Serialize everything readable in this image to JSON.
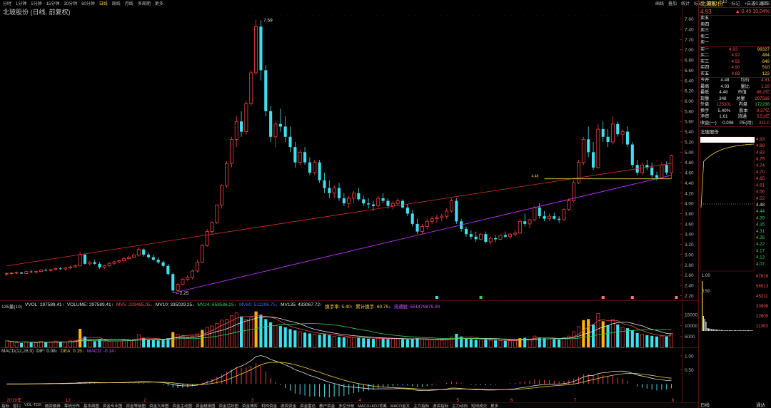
{
  "toolbar": {
    "left_items": [
      "分时",
      "1分钟",
      "5分钟",
      "15分钟",
      "30分钟",
      "60分钟",
      "日线",
      "周线",
      "月线",
      "多周期",
      "更多"
    ],
    "active_index": 6,
    "right_items": [
      "画线",
      "叠加",
      "统计",
      "标记",
      "回放",
      "F10",
      "标记",
      "+自选",
      "返回"
    ]
  },
  "subtitle": "北玻股份 (日线, 前复权)",
  "stock": {
    "name": "北玻股份",
    "code": "002613",
    "price": "4.93",
    "change": "0.45",
    "change_pct": "10.04%"
  },
  "order_book": {
    "sell": [
      {
        "label": "卖五",
        "price": "",
        "vol": ""
      },
      {
        "label": "卖四",
        "price": "",
        "vol": ""
      },
      {
        "label": "卖三",
        "price": "",
        "vol": ""
      },
      {
        "label": "卖二",
        "price": "",
        "vol": ""
      },
      {
        "label": "卖一",
        "price": "",
        "vol": ""
      }
    ],
    "buy": [
      {
        "label": "买一",
        "price": "4.93",
        "vol": "99327"
      },
      {
        "label": "买二",
        "price": "4.92",
        "vol": "484"
      },
      {
        "label": "买三",
        "price": "4.91",
        "vol": "649"
      },
      {
        "label": "买四",
        "price": "4.90",
        "vol": "510"
      },
      {
        "label": "买五",
        "price": "4.89",
        "vol": "122"
      }
    ]
  },
  "quote": [
    {
      "l1": "今开",
      "v1": "4.48",
      "l2": "均价",
      "v2": "4.81"
    },
    {
      "l1": "最高",
      "v1": "4.93",
      "l2": "量比",
      "v2": "1.18"
    },
    {
      "l1": "最低",
      "v1": "4.48",
      "l2": "市值",
      "v2": "46.2亿"
    },
    {
      "l1": "现量",
      "v1": "348",
      "l2": "总量",
      "v2": "297589"
    },
    {
      "l1": "外盘",
      "v1": "125301",
      "l2": "内盘",
      "v2": "172288"
    },
    {
      "l1": "换手",
      "v1": "5.40%",
      "l2": "股本",
      "v2": "9.37亿"
    },
    {
      "l1": "净资",
      "v1": "1.61",
      "l2": "流通",
      "v2": "5.51亿"
    },
    {
      "l1": "收益(一)",
      "v1": "0.006",
      "l2": "PE(动)",
      "v2": "211.0"
    }
  ],
  "mini_chart": {
    "title": "北玻股份",
    "price_ticks": [
      "4.93",
      "4.88",
      "4.83",
      "4.79",
      "4.74",
      "4.70",
      "4.65",
      "4.61",
      "4.56",
      "4.52",
      "4.48",
      "4.44",
      "4.39",
      "4.35",
      "4.31",
      "4.26",
      "4.22",
      "4.17",
      "4.13",
      "4.07"
    ],
    "vol_ticks": [
      "67816",
      "56513",
      "45211",
      "33908",
      "22605",
      "11303"
    ],
    "bottom_label": "日线",
    "bottom_right": "通达"
  },
  "chart_data": {
    "type": "candlestick",
    "y_ticks": [
      "7.60",
      "7.40",
      "7.20",
      "7.00",
      "6.80",
      "6.60",
      "6.40",
      "6.20",
      "6.00",
      "5.80",
      "5.60",
      "5.40",
      "5.20",
      "5.00",
      "4.80",
      "4.60",
      "4.40",
      "4.20",
      "4.00",
      "3.80",
      "3.60",
      "3.40",
      "3.20",
      "3.00",
      "2.80",
      "2.60",
      "2.40",
      "2.20"
    ],
    "ylim": [
      2.15,
      7.72
    ],
    "annotations": {
      "high": "7.59",
      "low": "2.25",
      "mid": "4.48"
    },
    "candles": [
      [
        2.62,
        2.65,
        2.58,
        2.63
      ],
      [
        2.63,
        2.66,
        2.6,
        2.64
      ],
      [
        2.64,
        2.67,
        2.61,
        2.65
      ],
      [
        2.65,
        2.66,
        2.62,
        2.63
      ],
      [
        2.63,
        2.68,
        2.62,
        2.67
      ],
      [
        2.67,
        2.7,
        2.64,
        2.66
      ],
      [
        2.66,
        2.68,
        2.63,
        2.67
      ],
      [
        2.67,
        2.72,
        2.65,
        2.7
      ],
      [
        2.7,
        2.73,
        2.67,
        2.69
      ],
      [
        2.69,
        2.72,
        2.66,
        2.71
      ],
      [
        2.71,
        2.75,
        2.69,
        2.73
      ],
      [
        2.73,
        2.76,
        2.7,
        2.72
      ],
      [
        2.72,
        2.75,
        2.69,
        2.74
      ],
      [
        2.74,
        2.78,
        2.72,
        2.76
      ],
      [
        2.76,
        2.8,
        2.74,
        2.78
      ],
      [
        2.78,
        3.05,
        2.77,
        3.0
      ],
      [
        3.0,
        3.02,
        2.8,
        2.82
      ],
      [
        2.82,
        2.88,
        2.78,
        2.85
      ],
      [
        2.85,
        2.9,
        2.8,
        2.82
      ],
      [
        2.82,
        2.86,
        2.72,
        2.75
      ],
      [
        2.75,
        2.8,
        2.72,
        2.78
      ],
      [
        2.78,
        2.85,
        2.76,
        2.83
      ],
      [
        2.83,
        2.88,
        2.8,
        2.86
      ],
      [
        2.86,
        2.9,
        2.83,
        2.88
      ],
      [
        2.88,
        2.95,
        2.85,
        2.92
      ],
      [
        2.92,
        2.98,
        2.9,
        2.95
      ],
      [
        2.95,
        3.02,
        2.93,
        2.99
      ],
      [
        2.99,
        3.15,
        2.96,
        3.1
      ],
      [
        3.1,
        3.12,
        2.96,
        3.0
      ],
      [
        3.0,
        3.05,
        2.92,
        2.95
      ],
      [
        2.95,
        3.0,
        2.88,
        2.9
      ],
      [
        2.9,
        2.95,
        2.82,
        2.85
      ],
      [
        2.85,
        2.88,
        2.75,
        2.78
      ],
      [
        2.78,
        2.82,
        2.6,
        2.62
      ],
      [
        2.62,
        2.65,
        2.25,
        2.3
      ],
      [
        2.3,
        2.45,
        2.28,
        2.42
      ],
      [
        2.42,
        2.55,
        2.4,
        2.52
      ],
      [
        2.52,
        2.6,
        2.48,
        2.55
      ],
      [
        2.55,
        2.7,
        2.52,
        2.68
      ],
      [
        2.68,
        2.9,
        2.65,
        2.85
      ],
      [
        2.85,
        3.2,
        2.84,
        3.18
      ],
      [
        3.18,
        3.5,
        3.15,
        3.45
      ],
      [
        3.45,
        3.65,
        3.4,
        3.62
      ],
      [
        3.62,
        3.98,
        3.6,
        3.97
      ],
      [
        3.97,
        4.37,
        3.9,
        4.35
      ],
      [
        4.35,
        4.82,
        4.3,
        4.78
      ],
      [
        4.78,
        5.3,
        4.7,
        5.25
      ],
      [
        5.25,
        5.7,
        5.1,
        5.6
      ],
      [
        5.6,
        5.8,
        5.3,
        5.4
      ],
      [
        5.4,
        6.0,
        5.35,
        5.95
      ],
      [
        5.95,
        6.6,
        5.9,
        6.55
      ],
      [
        6.55,
        7.59,
        6.5,
        7.45
      ],
      [
        7.45,
        7.55,
        6.4,
        6.6
      ],
      [
        6.6,
        6.7,
        5.7,
        5.8
      ],
      [
        5.8,
        5.9,
        5.2,
        5.3
      ],
      [
        5.3,
        5.6,
        5.1,
        5.55
      ],
      [
        5.55,
        5.85,
        5.4,
        5.5
      ],
      [
        5.5,
        5.7,
        5.2,
        5.3
      ],
      [
        5.3,
        5.5,
        5.0,
        5.1
      ],
      [
        5.1,
        5.2,
        4.7,
        4.8
      ],
      [
        4.8,
        5.05,
        4.75,
        5.0
      ],
      [
        5.0,
        5.1,
        4.75,
        4.8
      ],
      [
        4.8,
        4.9,
        4.55,
        4.6
      ],
      [
        4.6,
        4.85,
        4.55,
        4.8
      ],
      [
        4.8,
        4.85,
        4.4,
        4.45
      ],
      [
        4.45,
        4.6,
        4.2,
        4.3
      ],
      [
        4.3,
        4.45,
        4.1,
        4.2
      ],
      [
        4.2,
        4.35,
        4.1,
        4.3
      ],
      [
        4.3,
        4.4,
        4.05,
        4.1
      ],
      [
        4.1,
        4.2,
        3.95,
        4.0
      ],
      [
        4.0,
        4.15,
        3.9,
        4.1
      ],
      [
        4.1,
        4.25,
        4.0,
        4.2
      ],
      [
        4.2,
        4.3,
        4.05,
        4.08
      ],
      [
        4.08,
        4.15,
        3.95,
        4.0
      ],
      [
        4.0,
        4.1,
        3.9,
        3.98
      ],
      [
        3.98,
        4.05,
        3.85,
        3.95
      ],
      [
        3.95,
        4.15,
        3.92,
        4.1
      ],
      [
        4.1,
        4.2,
        4.0,
        4.05
      ],
      [
        4.05,
        4.1,
        3.9,
        3.95
      ],
      [
        3.95,
        4.05,
        3.88,
        4.0
      ],
      [
        4.0,
        4.1,
        3.95,
        4.05
      ],
      [
        4.05,
        4.08,
        3.9,
        3.92
      ],
      [
        3.92,
        3.98,
        3.75,
        3.8
      ],
      [
        3.8,
        3.88,
        3.55,
        3.6
      ],
      [
        3.6,
        3.7,
        3.4,
        3.45
      ],
      [
        3.45,
        3.6,
        3.4,
        3.55
      ],
      [
        3.55,
        3.7,
        3.5,
        3.65
      ],
      [
        3.65,
        3.75,
        3.6,
        3.7
      ],
      [
        3.7,
        3.78,
        3.62,
        3.72
      ],
      [
        3.72,
        3.8,
        3.65,
        3.75
      ],
      [
        3.75,
        3.9,
        3.7,
        3.85
      ],
      [
        3.85,
        4.1,
        3.82,
        4.05
      ],
      [
        4.05,
        4.1,
        3.6,
        3.65
      ],
      [
        3.65,
        3.7,
        3.45,
        3.5
      ],
      [
        3.5,
        3.55,
        3.35,
        3.4
      ],
      [
        3.4,
        3.48,
        3.3,
        3.35
      ],
      [
        3.35,
        3.45,
        3.25,
        3.3
      ],
      [
        3.3,
        3.42,
        3.28,
        3.4
      ],
      [
        3.4,
        3.45,
        3.22,
        3.25
      ],
      [
        3.25,
        3.35,
        3.2,
        3.32
      ],
      [
        3.32,
        3.38,
        3.25,
        3.3
      ],
      [
        3.3,
        3.4,
        3.28,
        3.38
      ],
      [
        3.38,
        3.45,
        3.32,
        3.35
      ],
      [
        3.35,
        3.42,
        3.3,
        3.4
      ],
      [
        3.4,
        3.48,
        3.35,
        3.42
      ],
      [
        3.42,
        3.7,
        3.4,
        3.65
      ],
      [
        3.65,
        3.8,
        3.55,
        3.6
      ],
      [
        3.6,
        3.7,
        3.52,
        3.68
      ],
      [
        3.68,
        3.95,
        3.65,
        3.92
      ],
      [
        3.92,
        4.0,
        3.7,
        3.75
      ],
      [
        3.75,
        3.85,
        3.65,
        3.7
      ],
      [
        3.7,
        3.8,
        3.65,
        3.75
      ],
      [
        3.75,
        3.82,
        3.68,
        3.7
      ],
      [
        3.7,
        3.75,
        3.62,
        3.68
      ],
      [
        3.68,
        3.9,
        3.66,
        3.88
      ],
      [
        3.88,
        4.1,
        3.85,
        4.05
      ],
      [
        4.05,
        4.45,
        4.02,
        4.4
      ],
      [
        4.4,
        4.85,
        4.38,
        4.8
      ],
      [
        4.8,
        5.3,
        4.75,
        5.25
      ],
      [
        5.25,
        5.5,
        4.9,
        5.0
      ],
      [
        5.0,
        5.2,
        4.65,
        4.7
      ],
      [
        4.7,
        5.55,
        4.68,
        5.45
      ],
      [
        5.45,
        5.6,
        5.2,
        5.3
      ],
      [
        5.3,
        5.45,
        5.1,
        5.2
      ],
      [
        5.2,
        5.7,
        5.15,
        5.55
      ],
      [
        5.55,
        5.6,
        5.3,
        5.35
      ],
      [
        5.35,
        5.45,
        5.15,
        5.4
      ],
      [
        5.4,
        5.5,
        5.1,
        5.15
      ],
      [
        5.15,
        5.2,
        4.7,
        4.75
      ],
      [
        4.75,
        4.85,
        4.55,
        4.6
      ],
      [
        4.6,
        4.8,
        4.55,
        4.75
      ],
      [
        4.75,
        4.85,
        4.65,
        4.7
      ],
      [
        4.7,
        4.8,
        4.5,
        4.55
      ],
      [
        4.55,
        4.62,
        4.45,
        4.5
      ],
      [
        4.5,
        4.8,
        4.48,
        4.75
      ],
      [
        4.75,
        4.82,
        4.55,
        4.6
      ],
      [
        4.6,
        4.95,
        4.48,
        4.93
      ]
    ],
    "volume": {
      "header": [
        {
          "text": "135量(10)",
          "color": "#c8c8c8"
        },
        {
          "text": "VVOL: 297589.41↑",
          "color": "#e0e0e0"
        },
        {
          "text": "VOLUME: 297589.41↑",
          "color": "#e0e0e0"
        },
        {
          "text": "MV5: 229495.05↓",
          "color": "#ff4d4d"
        },
        {
          "text": "MV10: 335029.25↓",
          "color": "#e0e0e0"
        },
        {
          "text": "MV24: 658586.25↓",
          "color": "#2fd35a"
        },
        {
          "text": "MV60: 511206.75↓",
          "color": "#3c6cff"
        },
        {
          "text": "MV135: 433067.72↑",
          "color": "#e0e0e0"
        },
        {
          "text": "换手率: 5.40↑",
          "color": "#ffd23c"
        },
        {
          "text": "累计换手: 60.75↓",
          "color": "#ffd23c"
        },
        {
          "text": "流通股: 551479875.00",
          "color": "#d452ff"
        }
      ],
      "ticks": [
        "15000",
        "10000",
        "5000"
      ],
      "ylim": [
        0,
        18000
      ],
      "values": [
        3000,
        2500,
        2200,
        2000,
        2600,
        2200,
        2100,
        2800,
        2400,
        2300,
        2900,
        2500,
        2400,
        3000,
        3200,
        8500,
        5000,
        3200,
        2800,
        3500,
        2600,
        2800,
        3000,
        2900,
        3400,
        3600,
        3800,
        5800,
        4400,
        3600,
        3300,
        3200,
        3500,
        4200,
        7000,
        6000,
        5500,
        4800,
        5200,
        6200,
        8000,
        9200,
        9800,
        11000,
        12500,
        13000,
        14500,
        15800,
        14200,
        12800,
        13500,
        16500,
        15000,
        13000,
        11500,
        10000,
        9800,
        9200,
        8400,
        7800,
        7200,
        6800,
        6400,
        6100,
        5800,
        6200,
        5600,
        5000,
        4800,
        4600,
        4500,
        4700,
        4400,
        4200,
        4000,
        3900,
        4300,
        4100,
        3800,
        3900,
        4000,
        3700,
        3600,
        3900,
        4200,
        3800,
        3600,
        3500,
        3400,
        3300,
        3600,
        4800,
        6200,
        5000,
        4200,
        3800,
        3500,
        3400,
        3600,
        3300,
        3200,
        3100,
        3000,
        3100,
        3200,
        4200,
        4400,
        3800,
        5200,
        4600,
        4200,
        3900,
        3700,
        3600,
        4400,
        5200,
        7200,
        9500,
        12500,
        13000,
        10500,
        15500,
        12000,
        10200,
        12800,
        10500,
        9200,
        8800,
        7800,
        6600,
        6100,
        5600,
        5300,
        5000,
        5200,
        5000,
        6400
      ],
      "highlight": [
        15,
        34,
        40,
        51,
        105,
        118,
        119,
        122
      ]
    },
    "macd": {
      "header": [
        {
          "text": "MACD(12,26,9)",
          "color": "#c8c8c8"
        },
        {
          "text": "DIF: 0.08↑",
          "color": "#e0e0e0"
        },
        {
          "text": "DEA: 0.15↓",
          "color": "#ffd23c"
        },
        {
          "text": "MACD: -0.14↑",
          "color": "#d452ff"
        }
      ],
      "ticks": [
        "1.00",
        "0.50"
      ],
      "ylim": [
        -0.55,
        1.05
      ]
    },
    "x_labels": [
      "2019年",
      "12",
      "2",
      "3",
      "4",
      "5",
      "6",
      "7",
      "8"
    ],
    "mini_ticks_right": [
      "4.93",
      "4.88",
      "4.83",
      "4.79",
      "4.74",
      "4.70",
      "4.65",
      "4.61",
      "4.56",
      "4.52",
      "4.48"
    ]
  },
  "bottom_tabs": [
    "指标",
    "窗口",
    "VOL-TDX",
    "融资融券",
    "筹码分布",
    "基本面图",
    "资金专业图",
    "资金等级图",
    "资金大单图",
    "资金主动图",
    "资金超级图",
    "资金活跃图",
    "资金博弈",
    "机构资金",
    "游资资金",
    "资金雷达",
    "散户资金",
    "多空分歧",
    "MACD+KDJ背离",
    "MACD金叉",
    "主力指标",
    "游资指标",
    "主力动向",
    "短线成交",
    "更多"
  ]
}
